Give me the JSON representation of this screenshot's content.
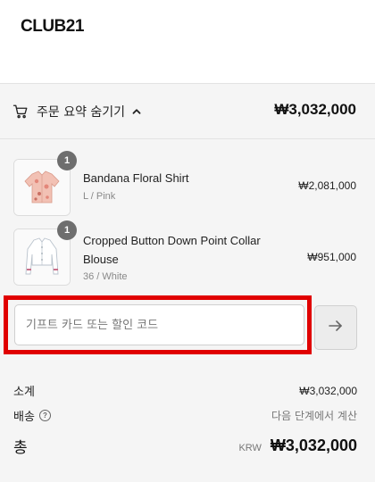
{
  "header": {
    "logo": "CLUB21"
  },
  "summary": {
    "toggle_label": "주문 요약 숨기기",
    "total": "₩3,032,000"
  },
  "items": [
    {
      "name": "Bandana Floral Shirt",
      "variant": "L / Pink",
      "price": "₩2,081,000",
      "quantity": "1"
    },
    {
      "name": "Cropped Button Down Point Collar Blouse",
      "variant": "36 / White",
      "price": "₩951,000",
      "quantity": "1"
    }
  ],
  "discount": {
    "placeholder": "기프트 카드 또는 할인 코드",
    "value": ""
  },
  "totals": {
    "subtotal_label": "소계",
    "subtotal_value": "₩3,032,000",
    "shipping_label": "배송",
    "shipping_value": "다음 단계에서 계산",
    "total_label": "총",
    "currency": "KRW",
    "total_value": "₩3,032,000"
  },
  "colors": {
    "highlight": "#e00000",
    "badge": "#6e6e6e",
    "panel": "#f5f5f5"
  },
  "icons": {
    "cart": "cart-icon",
    "toggle": "chevron-up-icon",
    "apply": "arrow-right-icon",
    "help": "help-circle-icon"
  }
}
